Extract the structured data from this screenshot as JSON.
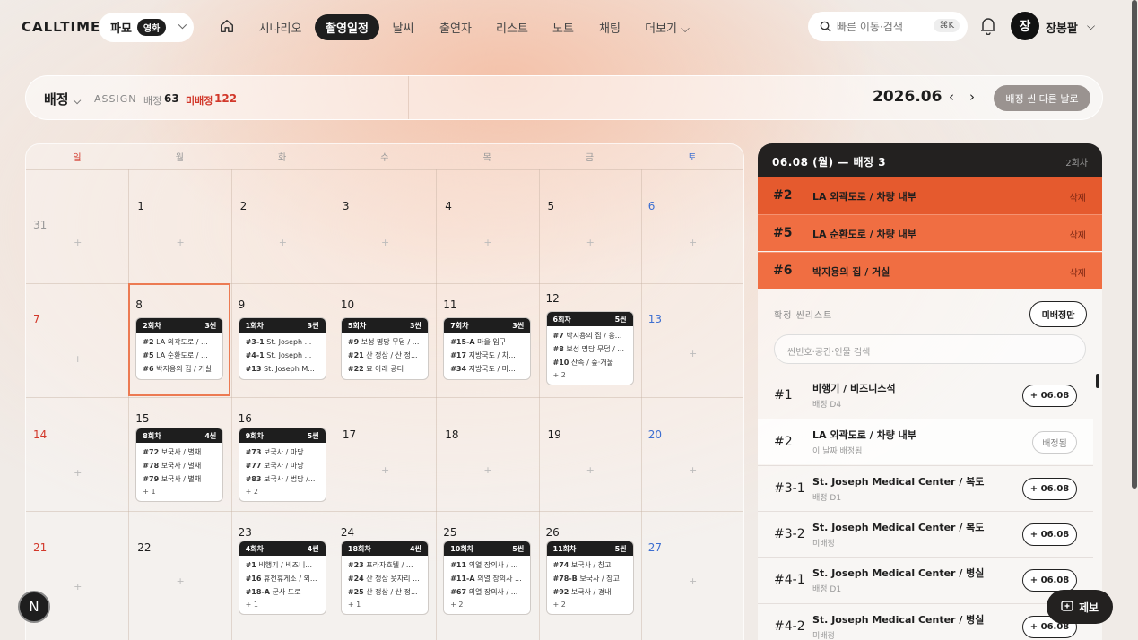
{
  "app": {
    "logo": "CALLTIME",
    "project": "파묘",
    "project_tag": "영화"
  },
  "nav": [
    {
      "label": "시나리오",
      "active": false
    },
    {
      "label": "촬영일정",
      "active": true
    },
    {
      "label": "날씨",
      "active": false
    },
    {
      "label": "출연자",
      "active": false
    },
    {
      "label": "리스트",
      "active": false
    },
    {
      "label": "노트",
      "active": false
    },
    {
      "label": "채팅",
      "active": false
    },
    {
      "label": "더보기 ⌵",
      "active": false
    }
  ],
  "search": {
    "placeholder": "빠른 이동·검색",
    "shortcut": "⌘K"
  },
  "user": {
    "initial": "장",
    "name": "장봉팔"
  },
  "assign": {
    "title": "배정",
    "subtitle": "ASSIGN",
    "assigned_label": "배정",
    "assigned_count": "63",
    "unassigned_label": "미배정",
    "unassigned_count": "122",
    "month": "2026.06",
    "move_button": "배정 씬 다른 날로"
  },
  "calendar": {
    "weekdays": [
      "일",
      "월",
      "화",
      "수",
      "목",
      "금",
      "토"
    ],
    "weeks": [
      [
        {
          "day": "31",
          "muted": true
        },
        {
          "day": "1"
        },
        {
          "day": "2"
        },
        {
          "day": "3"
        },
        {
          "day": "4"
        },
        {
          "day": "5"
        },
        {
          "day": "6"
        }
      ],
      [
        {
          "day": "7"
        },
        {
          "day": "8",
          "selected": true,
          "card": {
            "episode": "2회차",
            "count": "3씬",
            "lines": [
              [
                "#2",
                "LA 외곽도로 / ..."
              ],
              [
                "#5",
                "LA 순환도로 / ..."
              ],
              [
                "#6",
                "박지용의 집 / 거실"
              ]
            ]
          }
        },
        {
          "day": "9",
          "card": {
            "episode": "1회차",
            "count": "3씬",
            "lines": [
              [
                "#3-1",
                "St. Joseph ..."
              ],
              [
                "#4-1",
                "St. Joseph ..."
              ],
              [
                "#13",
                "St. Joseph M..."
              ]
            ]
          }
        },
        {
          "day": "10",
          "card": {
            "episode": "5회차",
            "count": "3씬",
            "lines": [
              [
                "#9",
                "보성 명당 무덤 / ..."
              ],
              [
                "#21",
                "산 정상 / 산 정..."
              ],
              [
                "#22",
                "묘 아래 공터"
              ]
            ]
          }
        },
        {
          "day": "11",
          "card": {
            "episode": "7회차",
            "count": "3씬",
            "lines": [
              [
                "#15-A",
                "마을 입구"
              ],
              [
                "#17",
                "지방국도 / 차..."
              ],
              [
                "#34",
                "지방국도 / 마..."
              ]
            ]
          }
        },
        {
          "day": "12",
          "card": {
            "episode": "6회차",
            "count": "5씬",
            "lines": [
              [
                "#7",
                "박지용의 집 / 응..."
              ],
              [
                "#8",
                "보성 명당 무덤 / ..."
              ],
              [
                "#10",
                "산속 / 숲·개울"
              ]
            ],
            "more": "+ 2"
          }
        },
        {
          "day": "13"
        }
      ],
      [
        {
          "day": "14"
        },
        {
          "day": "15",
          "card": {
            "episode": "8회차",
            "count": "4씬",
            "lines": [
              [
                "#72",
                "보국사 / 별채"
              ],
              [
                "#78",
                "보국사 / 별채"
              ],
              [
                "#79",
                "보국사 / 별채"
              ]
            ],
            "more": "+ 1"
          }
        },
        {
          "day": "16",
          "card": {
            "episode": "9회차",
            "count": "5씬",
            "lines": [
              [
                "#73",
                "보국사 / 마당"
              ],
              [
                "#77",
                "보국사 / 마당"
              ],
              [
                "#83",
                "보국사 / 법당 /..."
              ]
            ],
            "more": "+ 2"
          }
        },
        {
          "day": "17"
        },
        {
          "day": "18"
        },
        {
          "day": "19"
        },
        {
          "day": "20"
        }
      ],
      [
        {
          "day": "21"
        },
        {
          "day": "22"
        },
        {
          "day": "23",
          "card": {
            "episode": "4회차",
            "count": "4씬",
            "lines": [
              [
                "#1",
                "비행기 / 비즈니..."
              ],
              [
                "#16",
                "휴전휴게소 / 외..."
              ],
              [
                "#18-A",
                "군사 도로"
              ]
            ],
            "more": "+ 1"
          }
        },
        {
          "day": "24",
          "card": {
            "episode": "18회차",
            "count": "4씬",
            "lines": [
              [
                "#23",
                "프라자호텔 / ..."
              ],
              [
                "#24",
                "산 정상 묫자리 ..."
              ],
              [
                "#25",
                "산 정상 / 산 정..."
              ]
            ],
            "more": "+ 1"
          }
        },
        {
          "day": "25",
          "card": {
            "episode": "10회차",
            "count": "5씬",
            "lines": [
              [
                "#11",
                "의열 장의사 / ..."
              ],
              [
                "#11-A",
                "의열 장의사 ..."
              ],
              [
                "#67",
                "의열 장의사 / ..."
              ]
            ],
            "more": "+ 2"
          }
        },
        {
          "day": "26",
          "card": {
            "episode": "11회차",
            "count": "5씬",
            "lines": [
              [
                "#74",
                "보국사 / 창고"
              ],
              [
                "#78-B",
                "보국사 / 창고"
              ],
              [
                "#92",
                "보국사 / 경내"
              ]
            ],
            "more": "+ 2"
          }
        },
        {
          "day": "27"
        }
      ]
    ]
  },
  "panel": {
    "header": "06.08 (월) — 배정 3",
    "header_right": "2회차",
    "assigned": [
      {
        "no": "#2",
        "title": "LA 외곽도로 / 차량 내부",
        "action": "삭제",
        "color": "#e55a2e"
      },
      {
        "no": "#5",
        "title": "LA 순환도로 / 차량 내부",
        "action": "삭제",
        "color": "#f06e42"
      },
      {
        "no": "#6",
        "title": "박지용의 집 / 거실",
        "action": "삭제",
        "color": "#f06e42"
      }
    ],
    "list_label": "확정 씬리스트",
    "unassigned_only": "미배정만",
    "search_placeholder": "씬번호·공간·인물 검색",
    "scenes": [
      {
        "no": "#1",
        "title": "비행기 / 비즈니스석",
        "sub": "배정 D4",
        "btn": "+ 06.08",
        "done": false
      },
      {
        "no": "#2",
        "title": "LA 외곽도로 / 차량 내부",
        "sub": "이 날짜 배정됨",
        "btn": "배정됨",
        "done": true
      },
      {
        "no": "#3-1",
        "title": "St. Joseph Medical Center / 복도",
        "sub": "배정 D1",
        "btn": "+ 06.08",
        "done": false
      },
      {
        "no": "#3-2",
        "title": "St. Joseph Medical Center / 복도",
        "sub": "미배정",
        "btn": "+ 06.08",
        "done": false
      },
      {
        "no": "#4-1",
        "title": "St. Joseph Medical Center / 병실",
        "sub": "배정 D1",
        "btn": "+ 06.08",
        "done": false
      },
      {
        "no": "#4-2",
        "title": "St. Joseph Medical Center / 병실",
        "sub": "미배정",
        "btn": "+ 06.08",
        "done": false
      }
    ]
  },
  "footer": {
    "n_button": "N",
    "report": "제보"
  },
  "colors": {
    "accent": "#ec7a52",
    "sunday": "#d2382a",
    "saturday": "#3d6fd1"
  }
}
